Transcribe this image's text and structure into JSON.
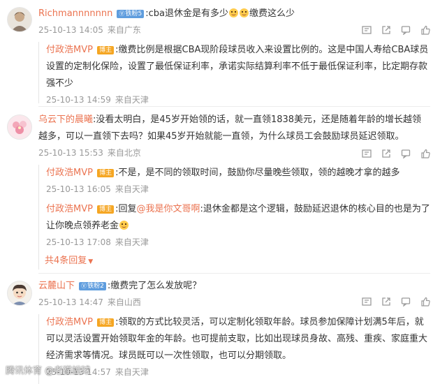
{
  "comments": [
    {
      "user": "Richmannnnnnn",
      "level_badge": "铁粉5",
      "text_a": ":cba退休金是有多少",
      "text_b": "缴费这么少",
      "meta": {
        "date": "25-10-13 14:05",
        "location": "来自广东"
      },
      "replies": [
        {
          "user": "付政浩MVP",
          "host_badge": "博主",
          "text": ":缴费比例是根据CBA现阶段球员收入来设置比例的。这是中国人寿给CBA球员设置的定制化保险，设置了最低保证利率，承诺实际结算利率不低于最低保证利率，比定期存款强不少",
          "meta": {
            "date": "25-10-13 14:59",
            "location": "来自天津"
          }
        }
      ]
    },
    {
      "user": "乌云下的晨曦",
      "text": ":没看太明白，是45岁开始领的话，就一直领1838美元，还是随着年龄的增长越领越多，可以一直领下去吗？如果45岁开始就能一直领，为什么球员工会鼓励球员延迟领取。",
      "meta": {
        "date": "25-10-13 15:53",
        "location": "来自北京"
      },
      "replies": [
        {
          "user": "付政浩MVP",
          "host_badge": "博主",
          "text": ":不是，是不同的领取时间，鼓励你尽量晚些领取，领的越晚才拿的越多",
          "meta": {
            "date": "25-10-13 16:05",
            "location": "来自天津"
          }
        },
        {
          "user": "付政浩MVP",
          "host_badge": "博主",
          "reply_prefix": ":回复",
          "mention": "@我是你文哥啊",
          "text_a": ":退休金都是这个逻辑，鼓励延迟退休的核心目的也是为了让你晚点领养老金",
          "meta": {
            "date": "25-10-13 17:08",
            "location": "来自天津"
          }
        }
      ],
      "more_replies": "共4条回复"
    },
    {
      "user": "云麓山下",
      "level_badge": "铁粉2",
      "text": ":缴费完了怎么发放呢？",
      "meta": {
        "date": "25-10-13 14:47",
        "location": "来自山西"
      },
      "replies": [
        {
          "user": "付政浩MVP",
          "host_badge": "博主",
          "text": ":领取的方式比较灵活，可以定制化领取年龄。球员参加保障计划满5年后，就可以灵活设置开始领取年金的年龄。也可提前支取，比如出现球员身故、高残、重疾、家庭重大经济需求等情况。球员既可以一次性领取，也可以分期领取。",
          "meta": {
            "date": "25-10-13 14:57",
            "location": "来自天津"
          }
        }
      ]
    }
  ],
  "watermark": "腾讯体育 @老猫說球",
  "icons": [
    "report-icon",
    "share-icon",
    "comment-icon",
    "like-icon"
  ]
}
